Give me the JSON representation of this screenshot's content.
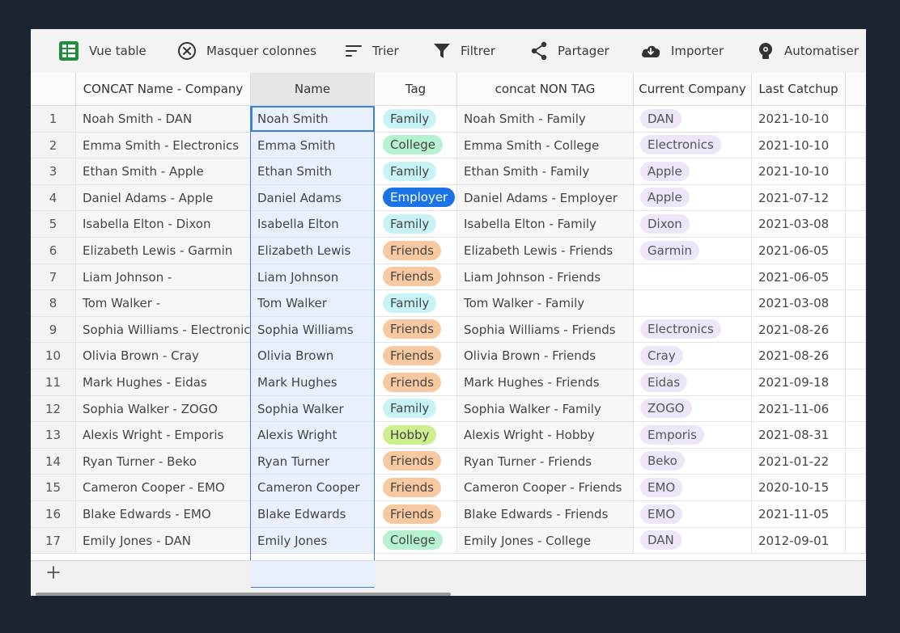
{
  "toolbar": {
    "items": [
      {
        "label": "Vue table",
        "icon": "sheet-icon"
      },
      {
        "label": "Masquer colonnes",
        "icon": "hide-columns-icon"
      },
      {
        "label": "Trier",
        "icon": "sort-icon"
      },
      {
        "label": "Filtrer",
        "icon": "filter-icon"
      },
      {
        "label": "Partager",
        "icon": "share-icon"
      },
      {
        "label": "Importer",
        "icon": "cloud-download-icon"
      },
      {
        "label": "Automatiser",
        "icon": "automate-icon"
      }
    ]
  },
  "colors": {
    "sheet_green": "#1e8e3e",
    "selection_blue": "#3b82d8",
    "tag_family": "#c8f3f6",
    "tag_college": "#b6f2cf",
    "tag_employer": "#1a73e8",
    "tag_friends": "#f8c9a1",
    "tag_hobby": "#cdef8e",
    "company_pill": "#ece6f8"
  },
  "table": {
    "columns": [
      "CONCAT Name - Company",
      "Name",
      "Tag",
      "concat NON TAG",
      "Current Company",
      "Last Catchup"
    ],
    "rows": [
      {
        "n": "1",
        "concat": "Noah Smith - DAN",
        "name": "Noah Smith",
        "tag": "Family",
        "tag_style": "family",
        "nontag": "Noah Smith - Family",
        "company": "DAN",
        "catchup": "2021-10-10"
      },
      {
        "n": "2",
        "concat": "Emma Smith - Electronics",
        "name": "Emma Smith",
        "tag": "College",
        "tag_style": "college",
        "nontag": "Emma Smith - College",
        "company": "Electronics",
        "catchup": "2021-10-10"
      },
      {
        "n": "3",
        "concat": "Ethan Smith - Apple",
        "name": "Ethan Smith",
        "tag": "Family",
        "tag_style": "family",
        "nontag": "Ethan Smith - Family",
        "company": "Apple",
        "catchup": "2021-10-10"
      },
      {
        "n": "4",
        "concat": "Daniel Adams - Apple",
        "name": "Daniel Adams",
        "tag": "Employer",
        "tag_style": "employer",
        "nontag": "Daniel Adams - Employer",
        "company": "Apple",
        "catchup": "2021-07-12"
      },
      {
        "n": "5",
        "concat": "Isabella Elton - Dixon",
        "name": "Isabella Elton",
        "tag": "Family",
        "tag_style": "family",
        "nontag": "Isabella Elton - Family",
        "company": "Dixon",
        "catchup": "2021-03-08"
      },
      {
        "n": "6",
        "concat": "Elizabeth Lewis - Garmin",
        "name": "Elizabeth Lewis",
        "tag": "Friends",
        "tag_style": "friends",
        "nontag": "Elizabeth Lewis - Friends",
        "company": "Garmin",
        "catchup": "2021-06-05"
      },
      {
        "n": "7",
        "concat": "Liam Johnson -",
        "name": "Liam Johnson",
        "tag": "Friends",
        "tag_style": "friends",
        "nontag": "Liam Johnson - Friends",
        "company": "",
        "catchup": "2021-06-05"
      },
      {
        "n": "8",
        "concat": "Tom Walker -",
        "name": "Tom Walker",
        "tag": "Family",
        "tag_style": "family",
        "nontag": "Tom Walker - Family",
        "company": "",
        "catchup": "2021-03-08"
      },
      {
        "n": "9",
        "concat": "Sophia Williams - Electronics",
        "name": "Sophia Williams",
        "tag": "Friends",
        "tag_style": "friends",
        "nontag": "Sophia Williams - Friends",
        "company": "Electronics",
        "catchup": "2021-08-26"
      },
      {
        "n": "10",
        "concat": "Olivia Brown - Cray",
        "name": "Olivia Brown",
        "tag": "Friends",
        "tag_style": "friends",
        "nontag": "Olivia Brown - Friends",
        "company": "Cray",
        "catchup": "2021-08-26"
      },
      {
        "n": "11",
        "concat": "Mark Hughes - Eidas",
        "name": "Mark Hughes",
        "tag": "Friends",
        "tag_style": "friends",
        "nontag": "Mark Hughes - Friends",
        "company": "Eidas",
        "catchup": "2021-09-18"
      },
      {
        "n": "12",
        "concat": "Sophia Walker - ZOGO",
        "name": "Sophia Walker",
        "tag": "Family",
        "tag_style": "family",
        "nontag": "Sophia Walker - Family",
        "company": "ZOGO",
        "catchup": "2021-11-06"
      },
      {
        "n": "13",
        "concat": "Alexis Wright - Emporis",
        "name": "Alexis Wright",
        "tag": "Hobby",
        "tag_style": "hobby",
        "nontag": "Alexis Wright - Hobby",
        "company": "Emporis",
        "catchup": "2021-08-31"
      },
      {
        "n": "14",
        "concat": "Ryan Turner - Beko",
        "name": "Ryan Turner",
        "tag": "Friends",
        "tag_style": "friends",
        "nontag": "Ryan Turner - Friends",
        "company": "Beko",
        "catchup": "2021-01-22"
      },
      {
        "n": "15",
        "concat": "Cameron Cooper - EMO",
        "name": "Cameron Cooper",
        "tag": "Friends",
        "tag_style": "friends",
        "nontag": "Cameron Cooper - Friends",
        "company": "EMO",
        "catchup": "2020-10-15"
      },
      {
        "n": "16",
        "concat": "Blake Edwards - EMO",
        "name": "Blake Edwards",
        "tag": "Friends",
        "tag_style": "friends",
        "nontag": "Blake Edwards - Friends",
        "company": "EMO",
        "catchup": "2021-11-05"
      },
      {
        "n": "17",
        "concat": "Emily Jones - DAN",
        "name": "Emily Jones",
        "tag": "College",
        "tag_style": "college",
        "nontag": "Emily Jones - College",
        "company": "DAN",
        "catchup": "2012-09-01"
      }
    ]
  },
  "add_row": {
    "icon": "plus-icon"
  }
}
